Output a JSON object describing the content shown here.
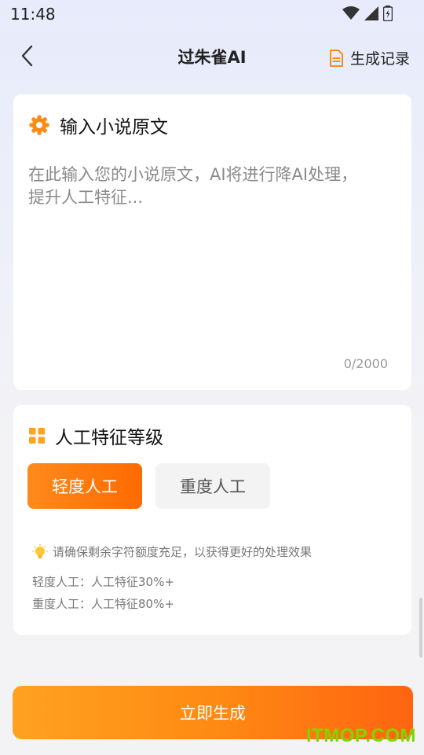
{
  "status_bar": {
    "time": "11:48"
  },
  "header": {
    "title": "过朱雀AI",
    "history_label": "生成记录"
  },
  "input_card": {
    "title": "输入小说原文",
    "placeholder": "在此输入您的小说原文，AI将进行降AI处理，提升人工特征...",
    "counter": "0/2000"
  },
  "level_card": {
    "title": "人工特征等级",
    "options": [
      {
        "label": "轻度人工",
        "selected": true
      },
      {
        "label": "重度人工",
        "selected": false
      }
    ],
    "tip": "请确保剩余字符额度充足，以获得更好的处理效果",
    "info": [
      "轻度人工：人工特征30%+",
      "重度人工：人工特征80%+"
    ]
  },
  "submit_label": "立即生成",
  "watermark": "ITMOP.COM",
  "colors": {
    "accent": "#ff7a12",
    "background": "#f3f3f6",
    "watermark": "#7fd600"
  }
}
